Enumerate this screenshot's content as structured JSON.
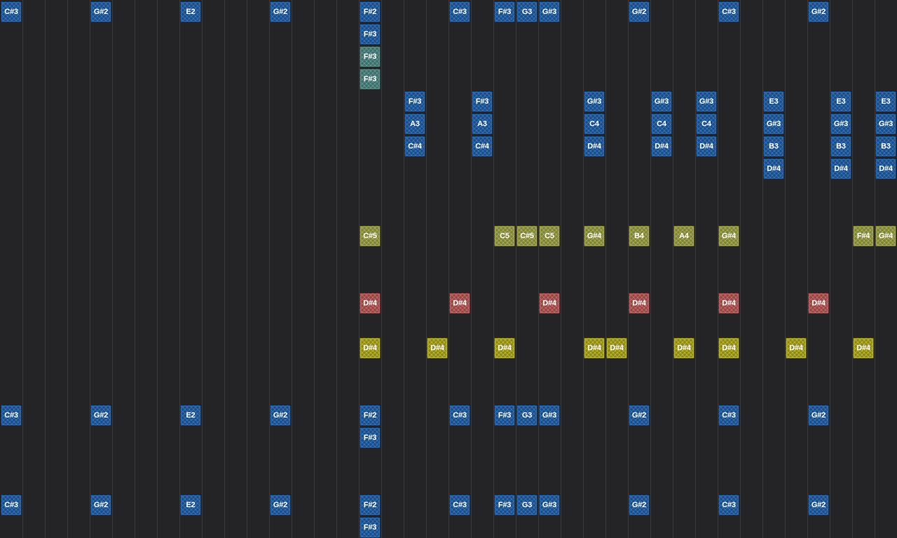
{
  "colors": {
    "background": "#242426",
    "grid_line": "#3a3a3d",
    "blue": "#174e8c",
    "teal": "#3d6f6c",
    "olive": "#7f8436",
    "red": "#9a4644",
    "yellow": "#8e8a14"
  },
  "notes": [
    {
      "label": "C#3",
      "col": 0,
      "row": 0,
      "color": "blue"
    },
    {
      "label": "G#2",
      "col": 4,
      "row": 0,
      "color": "blue"
    },
    {
      "label": "E2",
      "col": 8,
      "row": 0,
      "color": "blue"
    },
    {
      "label": "G#2",
      "col": 12,
      "row": 0,
      "color": "blue"
    },
    {
      "label": "F#2",
      "col": 16,
      "row": 0,
      "color": "blue"
    },
    {
      "label": "C#3",
      "col": 20,
      "row": 0,
      "color": "blue"
    },
    {
      "label": "F#3",
      "col": 22,
      "row": 0,
      "color": "blue"
    },
    {
      "label": "G3",
      "col": 23,
      "row": 0,
      "color": "blue"
    },
    {
      "label": "G#3",
      "col": 24,
      "row": 0,
      "color": "blue"
    },
    {
      "label": "G#2",
      "col": 28,
      "row": 0,
      "color": "blue"
    },
    {
      "label": "C#3",
      "col": 32,
      "row": 0,
      "color": "blue"
    },
    {
      "label": "G#2",
      "col": 36,
      "row": 0,
      "color": "blue"
    },
    {
      "label": "F#3",
      "col": 16,
      "row": 1,
      "color": "blue"
    },
    {
      "label": "F#3",
      "col": 16,
      "row": 2,
      "color": "teal"
    },
    {
      "label": "F#3",
      "col": 16,
      "row": 3,
      "color": "teal"
    },
    {
      "label": "F#3",
      "col": 18,
      "row": 4,
      "color": "blue"
    },
    {
      "label": "A3",
      "col": 18,
      "row": 5,
      "color": "blue"
    },
    {
      "label": "C#4",
      "col": 18,
      "row": 6,
      "color": "blue"
    },
    {
      "label": "F#3",
      "col": 21,
      "row": 4,
      "color": "blue"
    },
    {
      "label": "A3",
      "col": 21,
      "row": 5,
      "color": "blue"
    },
    {
      "label": "C#4",
      "col": 21,
      "row": 6,
      "color": "blue"
    },
    {
      "label": "G#3",
      "col": 26,
      "row": 4,
      "color": "blue"
    },
    {
      "label": "C4",
      "col": 26,
      "row": 5,
      "color": "blue"
    },
    {
      "label": "D#4",
      "col": 26,
      "row": 6,
      "color": "blue"
    },
    {
      "label": "G#3",
      "col": 29,
      "row": 4,
      "color": "blue"
    },
    {
      "label": "C4",
      "col": 29,
      "row": 5,
      "color": "blue"
    },
    {
      "label": "D#4",
      "col": 29,
      "row": 6,
      "color": "blue"
    },
    {
      "label": "G#3",
      "col": 31,
      "row": 4,
      "color": "blue"
    },
    {
      "label": "C4",
      "col": 31,
      "row": 5,
      "color": "blue"
    },
    {
      "label": "D#4",
      "col": 31,
      "row": 6,
      "color": "blue"
    },
    {
      "label": "E3",
      "col": 34,
      "row": 4,
      "color": "blue"
    },
    {
      "label": "G#3",
      "col": 34,
      "row": 5,
      "color": "blue"
    },
    {
      "label": "B3",
      "col": 34,
      "row": 6,
      "color": "blue"
    },
    {
      "label": "D#4",
      "col": 34,
      "row": 7,
      "color": "blue"
    },
    {
      "label": "E3",
      "col": 37,
      "row": 4,
      "color": "blue"
    },
    {
      "label": "G#3",
      "col": 37,
      "row": 5,
      "color": "blue"
    },
    {
      "label": "B3",
      "col": 37,
      "row": 6,
      "color": "blue"
    },
    {
      "label": "D#4",
      "col": 37,
      "row": 7,
      "color": "blue"
    },
    {
      "label": "E3",
      "col": 39,
      "row": 4,
      "color": "blue"
    },
    {
      "label": "G#3",
      "col": 39,
      "row": 5,
      "color": "blue"
    },
    {
      "label": "B3",
      "col": 39,
      "row": 6,
      "color": "blue"
    },
    {
      "label": "D#4",
      "col": 39,
      "row": 7,
      "color": "blue"
    },
    {
      "label": "C#5",
      "col": 16,
      "row": 10,
      "color": "olive"
    },
    {
      "label": "C5",
      "col": 22,
      "row": 10,
      "color": "olive"
    },
    {
      "label": "C#5",
      "col": 23,
      "row": 10,
      "color": "olive"
    },
    {
      "label": "C5",
      "col": 24,
      "row": 10,
      "color": "olive"
    },
    {
      "label": "G#4",
      "col": 26,
      "row": 10,
      "color": "olive"
    },
    {
      "label": "B4",
      "col": 28,
      "row": 10,
      "color": "olive"
    },
    {
      "label": "A4",
      "col": 30,
      "row": 10,
      "color": "olive"
    },
    {
      "label": "G#4",
      "col": 32,
      "row": 10,
      "color": "olive"
    },
    {
      "label": "F#4",
      "col": 38,
      "row": 10,
      "color": "olive"
    },
    {
      "label": "G#4",
      "col": 39,
      "row": 10,
      "color": "olive"
    },
    {
      "label": "D#4",
      "col": 16,
      "row": 13,
      "color": "red"
    },
    {
      "label": "D#4",
      "col": 20,
      "row": 13,
      "color": "red"
    },
    {
      "label": "D#4",
      "col": 24,
      "row": 13,
      "color": "red"
    },
    {
      "label": "D#4",
      "col": 28,
      "row": 13,
      "color": "red"
    },
    {
      "label": "D#4",
      "col": 32,
      "row": 13,
      "color": "red"
    },
    {
      "label": "D#4",
      "col": 36,
      "row": 13,
      "color": "red"
    },
    {
      "label": "D#4",
      "col": 16,
      "row": 15,
      "color": "yellow"
    },
    {
      "label": "D#4",
      "col": 19,
      "row": 15,
      "color": "yellow"
    },
    {
      "label": "D#4",
      "col": 22,
      "row": 15,
      "color": "yellow"
    },
    {
      "label": "D#4",
      "col": 26,
      "row": 15,
      "color": "yellow"
    },
    {
      "label": "D#4",
      "col": 27,
      "row": 15,
      "color": "yellow"
    },
    {
      "label": "D#4",
      "col": 30,
      "row": 15,
      "color": "yellow"
    },
    {
      "label": "D#4",
      "col": 32,
      "row": 15,
      "color": "yellow"
    },
    {
      "label": "D#4",
      "col": 35,
      "row": 15,
      "color": "yellow"
    },
    {
      "label": "D#4",
      "col": 38,
      "row": 15,
      "color": "yellow"
    },
    {
      "label": "C#3",
      "col": 0,
      "row": 18,
      "color": "blue"
    },
    {
      "label": "G#2",
      "col": 4,
      "row": 18,
      "color": "blue"
    },
    {
      "label": "E2",
      "col": 8,
      "row": 18,
      "color": "blue"
    },
    {
      "label": "G#2",
      "col": 12,
      "row": 18,
      "color": "blue"
    },
    {
      "label": "F#2",
      "col": 16,
      "row": 18,
      "color": "blue"
    },
    {
      "label": "C#3",
      "col": 20,
      "row": 18,
      "color": "blue"
    },
    {
      "label": "F#3",
      "col": 22,
      "row": 18,
      "color": "blue"
    },
    {
      "label": "G3",
      "col": 23,
      "row": 18,
      "color": "blue"
    },
    {
      "label": "G#3",
      "col": 24,
      "row": 18,
      "color": "blue"
    },
    {
      "label": "G#2",
      "col": 28,
      "row": 18,
      "color": "blue"
    },
    {
      "label": "C#3",
      "col": 32,
      "row": 18,
      "color": "blue"
    },
    {
      "label": "G#2",
      "col": 36,
      "row": 18,
      "color": "blue"
    },
    {
      "label": "F#3",
      "col": 16,
      "row": 19,
      "color": "blue"
    },
    {
      "label": "C#3",
      "col": 0,
      "row": 22,
      "color": "blue"
    },
    {
      "label": "G#2",
      "col": 4,
      "row": 22,
      "color": "blue"
    },
    {
      "label": "E2",
      "col": 8,
      "row": 22,
      "color": "blue"
    },
    {
      "label": "G#2",
      "col": 12,
      "row": 22,
      "color": "blue"
    },
    {
      "label": "F#2",
      "col": 16,
      "row": 22,
      "color": "blue"
    },
    {
      "label": "C#3",
      "col": 20,
      "row": 22,
      "color": "blue"
    },
    {
      "label": "F#3",
      "col": 22,
      "row": 22,
      "color": "blue"
    },
    {
      "label": "G3",
      "col": 23,
      "row": 22,
      "color": "blue"
    },
    {
      "label": "G#3",
      "col": 24,
      "row": 22,
      "color": "blue"
    },
    {
      "label": "G#2",
      "col": 28,
      "row": 22,
      "color": "blue"
    },
    {
      "label": "C#3",
      "col": 32,
      "row": 22,
      "color": "blue"
    },
    {
      "label": "G#2",
      "col": 36,
      "row": 22,
      "color": "blue"
    },
    {
      "label": "F#3",
      "col": 16,
      "row": 23,
      "color": "blue"
    }
  ]
}
